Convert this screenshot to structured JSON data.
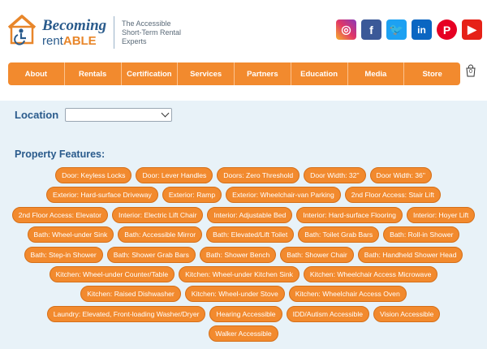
{
  "brand": {
    "name_part1": "Becoming",
    "name_part2": "rent",
    "name_part3": "ABLE",
    "tagline": "The Accessible Short-Term Rental Experts",
    "colors": {
      "blue": "#2a5b8c",
      "orange": "#f28a2e",
      "band": "#e8f2f8"
    }
  },
  "social": [
    {
      "name": "instagram-icon",
      "glyph": "◎"
    },
    {
      "name": "facebook-icon",
      "glyph": "f"
    },
    {
      "name": "twitter-icon",
      "glyph": "🐦"
    },
    {
      "name": "linkedin-icon",
      "glyph": "in"
    },
    {
      "name": "pinterest-icon",
      "glyph": "P"
    },
    {
      "name": "youtube-icon",
      "glyph": "▶"
    }
  ],
  "nav": {
    "items": [
      "About",
      "Rentals",
      "Certification",
      "Services",
      "Partners",
      "Education",
      "Media",
      "Store"
    ],
    "cart_count": "0"
  },
  "location": {
    "label": "Location",
    "selected": ""
  },
  "features": {
    "title": "Property Features:",
    "rows": [
      [
        "Door: Keyless Locks",
        "Door: Lever Handles",
        "Doors: Zero Threshold",
        "Door Width: 32\"",
        "Door Width: 36\""
      ],
      [
        "Exterior: Hard-surface Driveway",
        "Exterior: Ramp",
        "Exterior: Wheelchair-van Parking",
        "2nd Floor Access: Stair Lift"
      ],
      [
        "2nd Floor Access: Elevator",
        "Interior: Electric Lift Chair",
        "Interior: Adjustable Bed",
        "Interior: Hard-surface Flooring",
        "Interior: Hoyer Lift"
      ],
      [
        "Bath: Wheel-under Sink",
        "Bath: Accessible Mirror",
        "Bath: Elevated/Lift Toilet",
        "Bath: Toilet Grab Bars",
        "Bath: Roll-in Shower"
      ],
      [
        "Bath: Step-in Shower",
        "Bath: Shower Grab Bars",
        "Bath: Shower Bench",
        "Bath: Shower Chair",
        "Bath: Handheld Shower Head"
      ],
      [
        "Kitchen: Wheel-under Counter/Table",
        "Kitchen: Wheel-under Kitchen Sink",
        "Kitchen: Wheelchair Access Microwave"
      ],
      [
        "Kitchen: Raised Dishwasher",
        "Kitchen: Wheel-under Stove",
        "Kitchen: Wheelchair Access Oven"
      ],
      [
        "Laundry: Elevated, Front-loading Washer/Dryer",
        "Hearing Accessible",
        "IDD/Autism Accessible",
        "Vision Accessible"
      ],
      [
        "Walker Accessible"
      ]
    ]
  }
}
